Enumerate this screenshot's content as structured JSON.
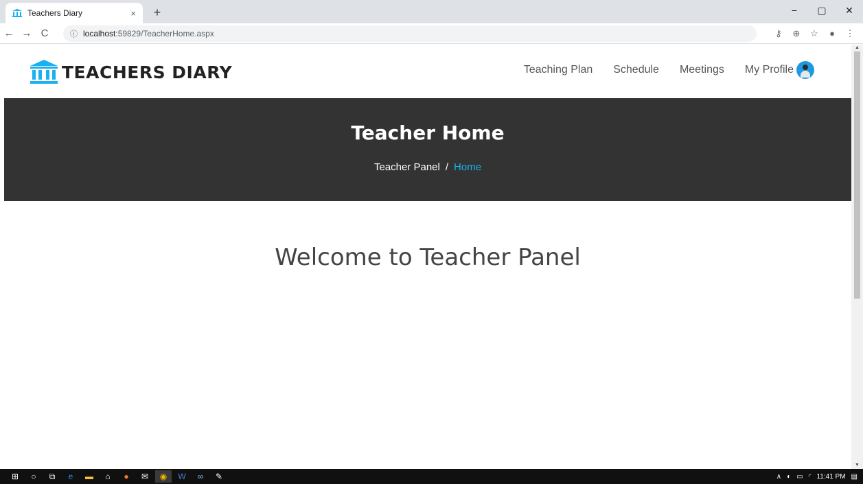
{
  "browser": {
    "tab_title": "Teachers Diary",
    "tab_close": "×",
    "new_tab": "+",
    "url_host": "localhost",
    "url_path": ":59829/TeacherHome.aspx",
    "controls": {
      "minimize": "−",
      "maximize": "▢",
      "close": "✕"
    },
    "nav": {
      "back": "←",
      "forward": "→",
      "reload": "C"
    },
    "toolbar_icons": {
      "key": "⚷",
      "zoom": "⊕",
      "star": "☆",
      "account": "●",
      "menu": "⋮"
    }
  },
  "site": {
    "logo_text": "TEACHERS DIARY",
    "brand_color": "#1bb1f0",
    "nav": [
      {
        "label": "Teaching Plan"
      },
      {
        "label": "Schedule"
      },
      {
        "label": "Meetings"
      },
      {
        "label": "My Profile"
      }
    ]
  },
  "banner": {
    "title": "Teacher Home",
    "breadcrumb": {
      "parent": "Teacher Panel",
      "separator": "/",
      "current": "Home"
    }
  },
  "main": {
    "welcome": "Welcome to Teacher Panel"
  },
  "taskbar": {
    "icons": [
      "windows-start-icon",
      "search-icon",
      "task-view-icon",
      "edge-icon",
      "file-explorer-icon",
      "store-icon",
      "firefox-icon",
      "mail-icon",
      "chrome-icon",
      "word-icon",
      "link-icon",
      "app-icon"
    ],
    "clock": "11:41 PM"
  }
}
